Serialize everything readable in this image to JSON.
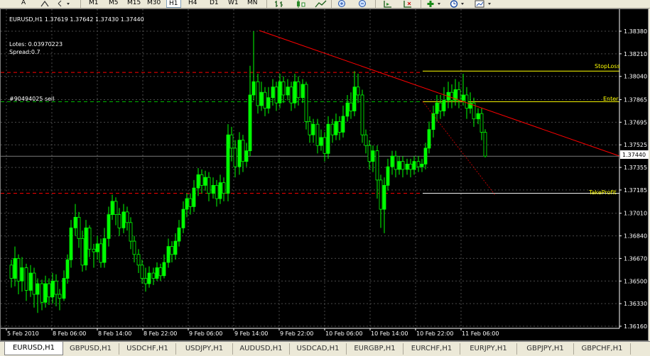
{
  "toolbar": {
    "text_tool": "A",
    "timeframes": [
      "M1",
      "M5",
      "M15",
      "M30",
      "H1",
      "H4",
      "D1",
      "W1",
      "MN"
    ],
    "active_timeframe": "H1",
    "icons": [
      "text-icon",
      "arrows-icon",
      "bar-chart-icon",
      "candle-chart-icon",
      "line-chart-icon",
      "zoom-in-icon",
      "zoom-out-icon",
      "autoscroll-icon",
      "chart-shift-icon",
      "indicators-icon",
      "periodicity-icon",
      "templates-icon"
    ]
  },
  "chart": {
    "header": "EURUSD,H1  1.37619 1.37642 1.37430 1.37440",
    "lotes": "Lotes: 0.03970223",
    "spread": "Spread:0.7",
    "order_label": "#90494025 sell",
    "line_labels": {
      "stoploss": "StopLoss",
      "enter": "Enter",
      "takeprofit": "TakeProfit"
    },
    "current_price": "1.37440",
    "colors": {
      "background": "#000000",
      "grid": "#4a4a4a",
      "bull": "#00ff00",
      "bear": "#000000",
      "wick": "#00ff00",
      "trendline": "#ff0000",
      "sl_tp_dashed": "#ff0000",
      "enter_dashed": "#00c000",
      "level_lines": "#ffff00",
      "labels": "#ffff00"
    }
  },
  "chart_data": {
    "type": "candlestick",
    "symbol": "EURUSD",
    "timeframe": "H1",
    "ohlc_last": {
      "open": 1.37619,
      "high": 1.37642,
      "low": 1.3743,
      "close": 1.3744
    },
    "price_ticks": [
      "1.38380",
      "1.38210",
      "1.38040",
      "1.37865",
      "1.37695",
      "1.37525",
      "1.37355",
      "1.37185",
      "1.37010",
      "1.36840",
      "1.36670",
      "1.36500",
      "1.36330",
      "1.36160"
    ],
    "time_ticks": [
      "5 Feb 2010",
      "8 Feb 06:00",
      "8 Feb 14:00",
      "8 Feb 22:00",
      "9 Feb 06:00",
      "9 Feb 14:00",
      "9 Feb 22:00",
      "10 Feb 06:00",
      "10 Feb 14:00",
      "10 Feb 22:00",
      "11 Feb 06:00"
    ],
    "levels": {
      "stoploss": 1.3808,
      "enter": 1.3785,
      "takeprofit": 1.3716,
      "order_dashed_top": 1.3807,
      "order_dashed_bottom": 1.3716
    },
    "grid": true
  },
  "tabs": [
    "EURUSD,H1",
    "GBPUSD,H1",
    "USDCHF,H1",
    "USDJPY,H1",
    "AUDUSD,H1",
    "USDCAD,H1",
    "EURGBP,H1",
    "EURCHF,H1",
    "EURJPY,H1",
    "GBPJPY,H1",
    "GBPCHF,H1"
  ],
  "active_tab": "EURUSD,H1"
}
